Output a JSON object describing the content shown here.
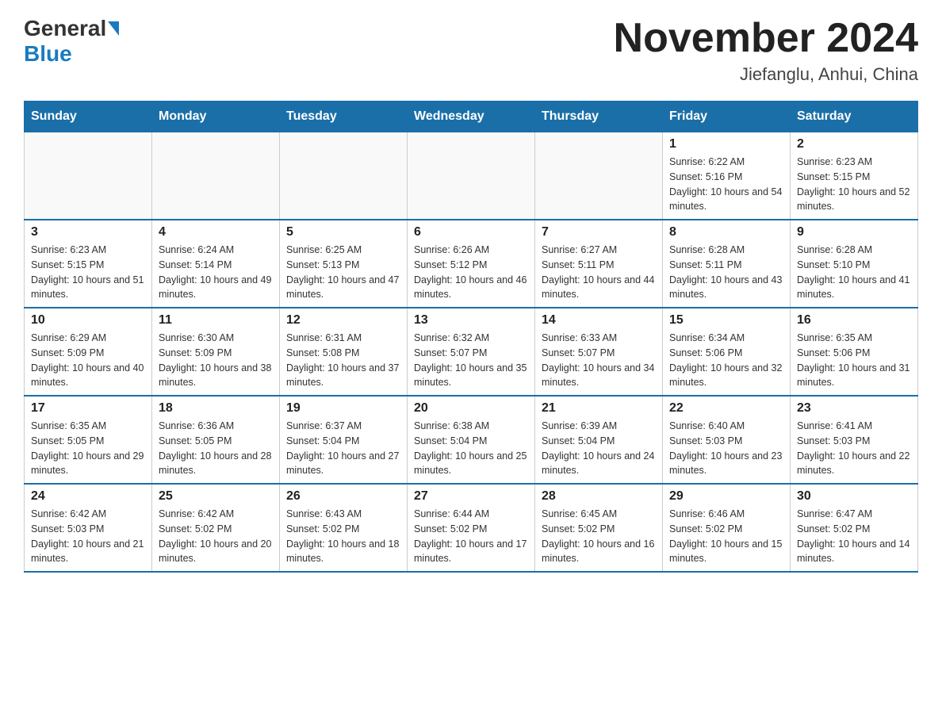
{
  "header": {
    "logo_general": "General",
    "logo_blue": "Blue",
    "title": "November 2024",
    "location": "Jiefanglu, Anhui, China"
  },
  "calendar": {
    "days_of_week": [
      "Sunday",
      "Monday",
      "Tuesday",
      "Wednesday",
      "Thursday",
      "Friday",
      "Saturday"
    ],
    "weeks": [
      [
        {
          "day": "",
          "sunrise": "",
          "sunset": "",
          "daylight": ""
        },
        {
          "day": "",
          "sunrise": "",
          "sunset": "",
          "daylight": ""
        },
        {
          "day": "",
          "sunrise": "",
          "sunset": "",
          "daylight": ""
        },
        {
          "day": "",
          "sunrise": "",
          "sunset": "",
          "daylight": ""
        },
        {
          "day": "",
          "sunrise": "",
          "sunset": "",
          "daylight": ""
        },
        {
          "day": "1",
          "sunrise": "Sunrise: 6:22 AM",
          "sunset": "Sunset: 5:16 PM",
          "daylight": "Daylight: 10 hours and 54 minutes."
        },
        {
          "day": "2",
          "sunrise": "Sunrise: 6:23 AM",
          "sunset": "Sunset: 5:15 PM",
          "daylight": "Daylight: 10 hours and 52 minutes."
        }
      ],
      [
        {
          "day": "3",
          "sunrise": "Sunrise: 6:23 AM",
          "sunset": "Sunset: 5:15 PM",
          "daylight": "Daylight: 10 hours and 51 minutes."
        },
        {
          "day": "4",
          "sunrise": "Sunrise: 6:24 AM",
          "sunset": "Sunset: 5:14 PM",
          "daylight": "Daylight: 10 hours and 49 minutes."
        },
        {
          "day": "5",
          "sunrise": "Sunrise: 6:25 AM",
          "sunset": "Sunset: 5:13 PM",
          "daylight": "Daylight: 10 hours and 47 minutes."
        },
        {
          "day": "6",
          "sunrise": "Sunrise: 6:26 AM",
          "sunset": "Sunset: 5:12 PM",
          "daylight": "Daylight: 10 hours and 46 minutes."
        },
        {
          "day": "7",
          "sunrise": "Sunrise: 6:27 AM",
          "sunset": "Sunset: 5:11 PM",
          "daylight": "Daylight: 10 hours and 44 minutes."
        },
        {
          "day": "8",
          "sunrise": "Sunrise: 6:28 AM",
          "sunset": "Sunset: 5:11 PM",
          "daylight": "Daylight: 10 hours and 43 minutes."
        },
        {
          "day": "9",
          "sunrise": "Sunrise: 6:28 AM",
          "sunset": "Sunset: 5:10 PM",
          "daylight": "Daylight: 10 hours and 41 minutes."
        }
      ],
      [
        {
          "day": "10",
          "sunrise": "Sunrise: 6:29 AM",
          "sunset": "Sunset: 5:09 PM",
          "daylight": "Daylight: 10 hours and 40 minutes."
        },
        {
          "day": "11",
          "sunrise": "Sunrise: 6:30 AM",
          "sunset": "Sunset: 5:09 PM",
          "daylight": "Daylight: 10 hours and 38 minutes."
        },
        {
          "day": "12",
          "sunrise": "Sunrise: 6:31 AM",
          "sunset": "Sunset: 5:08 PM",
          "daylight": "Daylight: 10 hours and 37 minutes."
        },
        {
          "day": "13",
          "sunrise": "Sunrise: 6:32 AM",
          "sunset": "Sunset: 5:07 PM",
          "daylight": "Daylight: 10 hours and 35 minutes."
        },
        {
          "day": "14",
          "sunrise": "Sunrise: 6:33 AM",
          "sunset": "Sunset: 5:07 PM",
          "daylight": "Daylight: 10 hours and 34 minutes."
        },
        {
          "day": "15",
          "sunrise": "Sunrise: 6:34 AM",
          "sunset": "Sunset: 5:06 PM",
          "daylight": "Daylight: 10 hours and 32 minutes."
        },
        {
          "day": "16",
          "sunrise": "Sunrise: 6:35 AM",
          "sunset": "Sunset: 5:06 PM",
          "daylight": "Daylight: 10 hours and 31 minutes."
        }
      ],
      [
        {
          "day": "17",
          "sunrise": "Sunrise: 6:35 AM",
          "sunset": "Sunset: 5:05 PM",
          "daylight": "Daylight: 10 hours and 29 minutes."
        },
        {
          "day": "18",
          "sunrise": "Sunrise: 6:36 AM",
          "sunset": "Sunset: 5:05 PM",
          "daylight": "Daylight: 10 hours and 28 minutes."
        },
        {
          "day": "19",
          "sunrise": "Sunrise: 6:37 AM",
          "sunset": "Sunset: 5:04 PM",
          "daylight": "Daylight: 10 hours and 27 minutes."
        },
        {
          "day": "20",
          "sunrise": "Sunrise: 6:38 AM",
          "sunset": "Sunset: 5:04 PM",
          "daylight": "Daylight: 10 hours and 25 minutes."
        },
        {
          "day": "21",
          "sunrise": "Sunrise: 6:39 AM",
          "sunset": "Sunset: 5:04 PM",
          "daylight": "Daylight: 10 hours and 24 minutes."
        },
        {
          "day": "22",
          "sunrise": "Sunrise: 6:40 AM",
          "sunset": "Sunset: 5:03 PM",
          "daylight": "Daylight: 10 hours and 23 minutes."
        },
        {
          "day": "23",
          "sunrise": "Sunrise: 6:41 AM",
          "sunset": "Sunset: 5:03 PM",
          "daylight": "Daylight: 10 hours and 22 minutes."
        }
      ],
      [
        {
          "day": "24",
          "sunrise": "Sunrise: 6:42 AM",
          "sunset": "Sunset: 5:03 PM",
          "daylight": "Daylight: 10 hours and 21 minutes."
        },
        {
          "day": "25",
          "sunrise": "Sunrise: 6:42 AM",
          "sunset": "Sunset: 5:02 PM",
          "daylight": "Daylight: 10 hours and 20 minutes."
        },
        {
          "day": "26",
          "sunrise": "Sunrise: 6:43 AM",
          "sunset": "Sunset: 5:02 PM",
          "daylight": "Daylight: 10 hours and 18 minutes."
        },
        {
          "day": "27",
          "sunrise": "Sunrise: 6:44 AM",
          "sunset": "Sunset: 5:02 PM",
          "daylight": "Daylight: 10 hours and 17 minutes."
        },
        {
          "day": "28",
          "sunrise": "Sunrise: 6:45 AM",
          "sunset": "Sunset: 5:02 PM",
          "daylight": "Daylight: 10 hours and 16 minutes."
        },
        {
          "day": "29",
          "sunrise": "Sunrise: 6:46 AM",
          "sunset": "Sunset: 5:02 PM",
          "daylight": "Daylight: 10 hours and 15 minutes."
        },
        {
          "day": "30",
          "sunrise": "Sunrise: 6:47 AM",
          "sunset": "Sunset: 5:02 PM",
          "daylight": "Daylight: 10 hours and 14 minutes."
        }
      ]
    ]
  }
}
